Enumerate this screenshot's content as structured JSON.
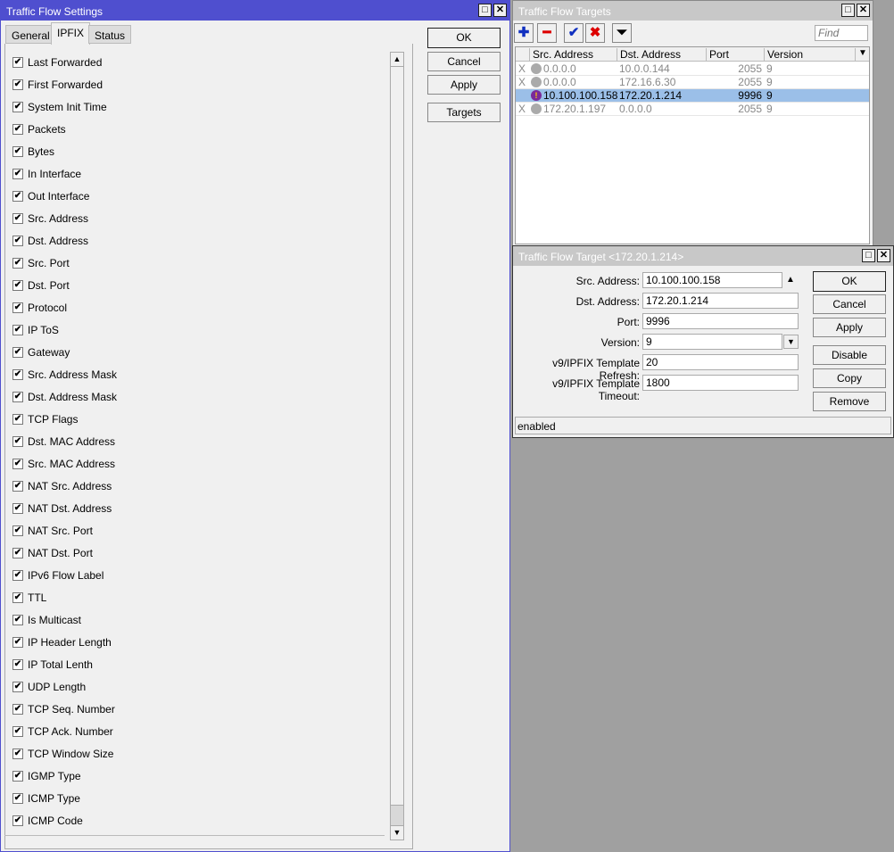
{
  "settings": {
    "title": "Traffic Flow Settings",
    "tabs": [
      "General",
      "IPFIX",
      "Status"
    ],
    "items": [
      "Last Forwarded",
      "First Forwarded",
      "System Init Time",
      "Packets",
      "Bytes",
      "In Interface",
      "Out Interface",
      "Src. Address",
      "Dst. Address",
      "Src. Port",
      "Dst. Port",
      "Protocol",
      "IP ToS",
      "Gateway",
      "Src. Address Mask",
      "Dst. Address Mask",
      "TCP Flags",
      "Dst. MAC Address",
      "Src. MAC Address",
      "NAT Src. Address",
      "NAT Dst. Address",
      "NAT Src. Port",
      "NAT Dst. Port",
      "IPv6 Flow Label",
      "TTL",
      "Is Multicast",
      "IP Header Length",
      "IP Total Lenth",
      "UDP Length",
      "TCP Seq. Number",
      "TCP Ack. Number",
      "TCP Window Size",
      "IGMP Type",
      "ICMP Type",
      "ICMP Code"
    ],
    "check": "✔",
    "buttons": {
      "ok": "OK",
      "cancel": "Cancel",
      "apply": "Apply",
      "targets": "Targets"
    }
  },
  "targets": {
    "title": "Traffic Flow Targets",
    "find_placeholder": "Find",
    "columns": [
      "Src. Address",
      "Dst. Address",
      "Port",
      "Version"
    ],
    "rows": [
      {
        "flag": "X",
        "src": "0.0.0.0",
        "dst": "10.0.0.144",
        "port": "2055",
        "version": "9",
        "disabled": true
      },
      {
        "flag": "X",
        "src": "0.0.0.0",
        "dst": "172.16.6.30",
        "port": "2055",
        "version": "9",
        "disabled": true
      },
      {
        "flag": "",
        "src": "10.100.100.158",
        "dst": "172.20.1.214",
        "port": "9996",
        "version": "9",
        "selected": true
      },
      {
        "flag": "X",
        "src": "172.20.1.197",
        "dst": "0.0.0.0",
        "port": "2055",
        "version": "9",
        "disabled": true
      }
    ]
  },
  "target": {
    "title": "Traffic Flow Target <172.20.1.214>",
    "fields": [
      {
        "label": "Src. Address:",
        "value": "10.100.100.158"
      },
      {
        "label": "Dst. Address:",
        "value": "172.20.1.214"
      },
      {
        "label": "Port:",
        "value": "9996"
      },
      {
        "label": "Version:",
        "value": "9"
      },
      {
        "label": "v9/IPFIX Template Refresh:",
        "value": "20"
      },
      {
        "label": "v9/IPFIX Template Timeout:",
        "value": "1800"
      }
    ],
    "buttons": {
      "ok": "OK",
      "cancel": "Cancel",
      "apply": "Apply",
      "disable": "Disable",
      "copy": "Copy",
      "remove": "Remove"
    },
    "status": "enabled"
  },
  "colors": {
    "active_title": "#4f4fcf",
    "inactive_title": "#c8c8c8",
    "selected_row": "#9bbfe8"
  }
}
